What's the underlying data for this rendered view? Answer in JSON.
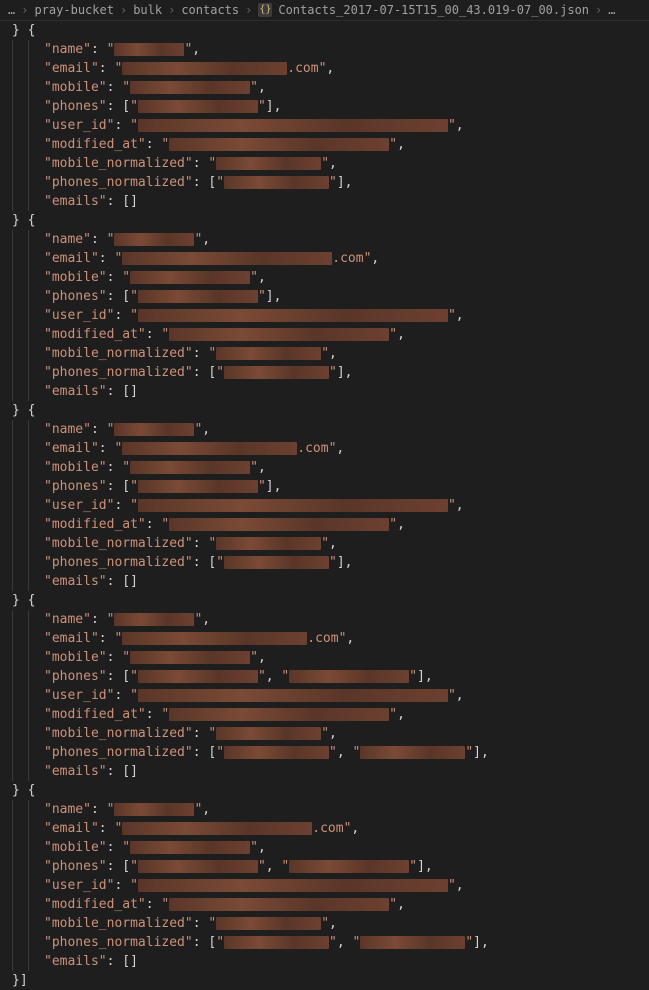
{
  "breadcrumb": {
    "seg0": "…",
    "seg1": "pray-bucket",
    "seg2": "bulk",
    "seg3": "contacts",
    "file": "Contacts_2017-07-15T15_00_43.019-07_00.json",
    "trail": "…"
  },
  "tokens": {
    "brace_close_open": "} {",
    "brace_close_bracket": "}]",
    "key_name": "\"name\"",
    "key_email": "\"email\"",
    "key_mobile": "\"mobile\"",
    "key_phones": "\"phones\"",
    "key_user_id": "\"user_id\"",
    "key_modified_at": "\"modified_at\"",
    "key_mobile_normalized": "\"mobile_normalized\"",
    "key_phones_normalized": "\"phones_normalized\"",
    "key_emails": "\"emails\"",
    "colon": ": ",
    "quote": "\"",
    "comma": ",",
    "lbracket": "[",
    "rbracket": "]",
    "empty_array": "[]",
    "dotcom": ".com"
  },
  "records": [
    {
      "name_w": 70,
      "email_pre_w": 165,
      "email_suffix": ".com",
      "mobile_w": 120,
      "phones": [
        120
      ],
      "user_id_w": 310,
      "modified_at_w": 220,
      "mobile_norm_w": 105,
      "phones_norm": [
        105
      ]
    },
    {
      "name_w": 80,
      "email_pre_w": 210,
      "email_suffix": ".com",
      "mobile_w": 120,
      "phones": [
        120
      ],
      "user_id_w": 310,
      "modified_at_w": 220,
      "mobile_norm_w": 105,
      "phones_norm": [
        105
      ]
    },
    {
      "name_w": 80,
      "email_pre_w": 175,
      "email_suffix": ".com",
      "mobile_w": 120,
      "phones": [
        120
      ],
      "user_id_w": 310,
      "modified_at_w": 220,
      "mobile_norm_w": 105,
      "phones_norm": [
        105
      ]
    },
    {
      "name_w": 80,
      "email_pre_w": 185,
      "email_suffix": ".com\"",
      "mobile_w": 120,
      "phones": [
        120,
        120
      ],
      "user_id_w": 310,
      "modified_at_w": 220,
      "mobile_norm_w": 105,
      "phones_norm": [
        105,
        105
      ]
    },
    {
      "name_w": 80,
      "email_pre_w": 190,
      "email_suffix": ".com",
      "mobile_w": 120,
      "phones": [
        120,
        120
      ],
      "user_id_w": 310,
      "modified_at_w": 220,
      "mobile_norm_w": 105,
      "phones_norm": [
        105,
        105
      ]
    }
  ]
}
